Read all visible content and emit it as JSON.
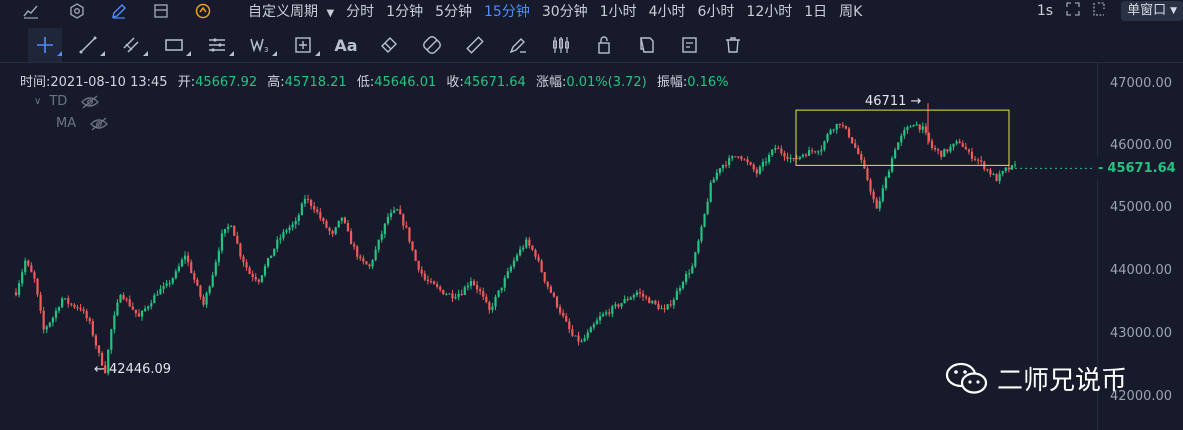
{
  "toolbar_top": {
    "icons": [
      "chart-line-icon",
      "settings-hexagon-icon",
      "pen-icon",
      "layout-icon",
      "target-icon"
    ],
    "custom_period_label": "自定义周期",
    "periods": [
      "分时",
      "1分钟",
      "5分钟",
      "15分钟",
      "30分钟",
      "1小时",
      "4小时",
      "6小时",
      "12小时",
      "1日",
      "周K"
    ],
    "active_period": "15分钟",
    "refresh_label": "1s",
    "window_label": "单窗口"
  },
  "drawing_tools": [
    "crosshair",
    "trend-line",
    "parallel-lines",
    "rectangle",
    "horizontal-lines",
    "wave-w3",
    "measure-plus",
    "text-aa",
    "eraser-tag",
    "circle-slash",
    "ruler",
    "paint",
    "candle-bars",
    "lock",
    "copy",
    "edit",
    "trash"
  ],
  "info": {
    "time_label": "时间:",
    "time": "2021-08-10 13:45",
    "open_label": "开:",
    "open": "45667.92",
    "high_label": "高:",
    "high": "45718.21",
    "low_label": "低:",
    "low": "45646.01",
    "close_label": "收:",
    "close": "45671.64",
    "change_label": "涨幅:",
    "change": "0.01%(3.72)",
    "amplitude_label": "振幅:",
    "amplitude": "0.16%"
  },
  "indicators": [
    {
      "name": "TD",
      "arrow": "v"
    },
    {
      "name": "MA",
      "arrow": ""
    }
  ],
  "axis": {
    "ticks": [
      "47000.00",
      "46000.00",
      "45000.00",
      "44000.00",
      "43000.00",
      "42000.00"
    ],
    "current_price": "45671.64"
  },
  "annotations": {
    "high_marker": "46711 →",
    "low_marker": "← 42446.09"
  },
  "watermark": "二师兄说币",
  "colors": {
    "up": "#26c281",
    "down": "#ef5b5b",
    "accent": "#4f8cff",
    "box": "#e6e63c"
  },
  "chart_data": {
    "type": "candlestick",
    "ylim": [
      41700,
      47400
    ],
    "current": 45671.64,
    "range_box": {
      "high": 46600,
      "low": 45720
    },
    "path": [
      [
        0,
        43700
      ],
      [
        3,
        44200
      ],
      [
        6,
        43900
      ],
      [
        9,
        43100
      ],
      [
        12,
        43300
      ],
      [
        15,
        43600
      ],
      [
        18,
        43500
      ],
      [
        21,
        43450
      ],
      [
        24,
        43200
      ],
      [
        27,
        42700
      ],
      [
        29,
        42446
      ],
      [
        31,
        43100
      ],
      [
        34,
        43700
      ],
      [
        37,
        43500
      ],
      [
        40,
        43300
      ],
      [
        43,
        43500
      ],
      [
        46,
        43700
      ],
      [
        49,
        43800
      ],
      [
        52,
        44000
      ],
      [
        55,
        44300
      ],
      [
        58,
        43900
      ],
      [
        61,
        43500
      ],
      [
        64,
        44000
      ],
      [
        67,
        44600
      ],
      [
        70,
        44800
      ],
      [
        73,
        44300
      ],
      [
        76,
        44000
      ],
      [
        79,
        43900
      ],
      [
        82,
        44200
      ],
      [
        85,
        44500
      ],
      [
        88,
        44700
      ],
      [
        91,
        44800
      ],
      [
        94,
        45200
      ],
      [
        97,
        45050
      ],
      [
        100,
        44800
      ],
      [
        103,
        44600
      ],
      [
        106,
        44900
      ],
      [
        109,
        44500
      ],
      [
        112,
        44200
      ],
      [
        115,
        44100
      ],
      [
        118,
        44500
      ],
      [
        121,
        44900
      ],
      [
        124,
        45000
      ],
      [
        127,
        44700
      ],
      [
        130,
        44200
      ],
      [
        133,
        43900
      ],
      [
        136,
        43800
      ],
      [
        139,
        43700
      ],
      [
        142,
        43650
      ],
      [
        145,
        43700
      ],
      [
        148,
        43900
      ],
      [
        151,
        43700
      ],
      [
        154,
        43400
      ],
      [
        157,
        43700
      ],
      [
        160,
        44000
      ],
      [
        163,
        44300
      ],
      [
        166,
        44500
      ],
      [
        169,
        44300
      ],
      [
        172,
        43900
      ],
      [
        175,
        43600
      ],
      [
        178,
        43300
      ],
      [
        181,
        43000
      ],
      [
        184,
        42900
      ],
      [
        187,
        43100
      ],
      [
        190,
        43300
      ],
      [
        193,
        43400
      ],
      [
        196,
        43500
      ],
      [
        199,
        43600
      ],
      [
        202,
        43700
      ],
      [
        205,
        43600
      ],
      [
        208,
        43500
      ],
      [
        211,
        43400
      ],
      [
        214,
        43600
      ],
      [
        217,
        43900
      ],
      [
        220,
        44100
      ],
      [
        223,
        44700
      ],
      [
        226,
        45400
      ],
      [
        229,
        45700
      ],
      [
        232,
        45800
      ],
      [
        235,
        45900
      ],
      [
        238,
        45750
      ],
      [
        241,
        45600
      ],
      [
        244,
        45800
      ],
      [
        247,
        46000
      ],
      [
        250,
        45900
      ],
      [
        253,
        45800
      ],
      [
        256,
        45900
      ],
      [
        259,
        45950
      ],
      [
        262,
        46000
      ],
      [
        265,
        46300
      ],
      [
        268,
        46400
      ],
      [
        271,
        46200
      ],
      [
        274,
        45900
      ],
      [
        277,
        45500
      ],
      [
        280,
        45000
      ],
      [
        283,
        45500
      ],
      [
        286,
        46000
      ],
      [
        289,
        46250
      ],
      [
        292,
        46400
      ],
      [
        295,
        46300
      ],
      [
        298,
        46000
      ],
      [
        301,
        45900
      ],
      [
        304,
        46000
      ],
      [
        307,
        46100
      ],
      [
        310,
        45900
      ],
      [
        313,
        45800
      ],
      [
        316,
        45650
      ],
      [
        319,
        45500
      ],
      [
        322,
        45650
      ],
      [
        325,
        45700
      ]
    ],
    "high_point": 46711,
    "low_point": 42446.09
  }
}
